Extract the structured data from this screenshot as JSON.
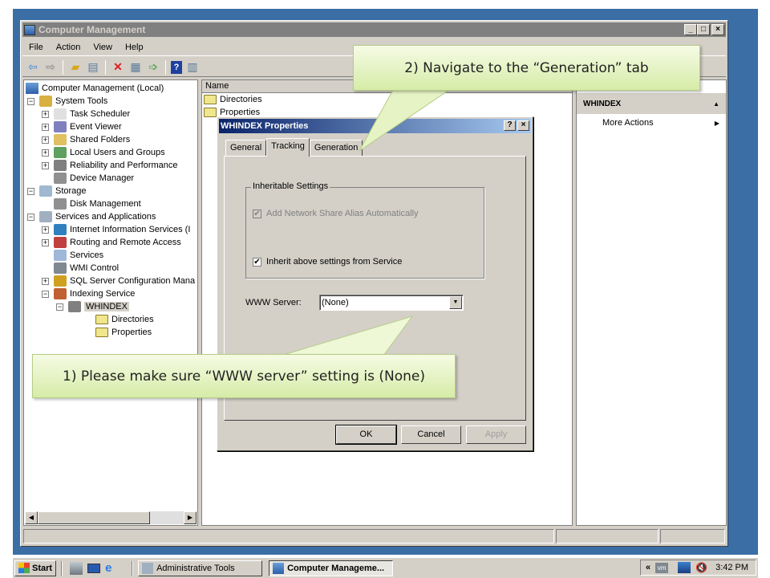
{
  "window": {
    "title": "Computer Management",
    "controls": {
      "minimize": "_",
      "maximize": "□",
      "close": "×"
    }
  },
  "menubar": [
    "File",
    "Action",
    "View",
    "Help"
  ],
  "toolbar": [
    "back-icon",
    "forward-icon",
    "up-folder-icon",
    "show-hide-tree-icon",
    "delete-icon",
    "properties-icon",
    "export-icon",
    "help-icon",
    "show-hide-action-pane-icon"
  ],
  "tree": {
    "root": "Computer Management (Local)",
    "items": [
      {
        "label": "System Tools",
        "expander": "−"
      },
      {
        "label": "Task Scheduler",
        "expander": "+"
      },
      {
        "label": "Event Viewer",
        "expander": "+"
      },
      {
        "label": "Shared Folders",
        "expander": "+"
      },
      {
        "label": "Local Users and Groups",
        "expander": "+"
      },
      {
        "label": "Reliability and Performance",
        "expander": "+"
      },
      {
        "label": "Device Manager",
        "expander": ""
      },
      {
        "label": "Storage",
        "expander": "−"
      },
      {
        "label": "Disk Management",
        "expander": ""
      },
      {
        "label": "Services and Applications",
        "expander": "−"
      },
      {
        "label": "Internet Information Services (I",
        "expander": "+"
      },
      {
        "label": "Routing and Remote Access",
        "expander": "+"
      },
      {
        "label": "Services",
        "expander": ""
      },
      {
        "label": "WMI Control",
        "expander": ""
      },
      {
        "label": "SQL Server Configuration Mana",
        "expander": "+"
      },
      {
        "label": "Indexing Service",
        "expander": "−"
      },
      {
        "label": "WHINDEX",
        "expander": "−"
      },
      {
        "label": "Directories",
        "expander": ""
      },
      {
        "label": "Properties",
        "expander": ""
      }
    ]
  },
  "list": {
    "header": "Name",
    "rows": [
      "Directories",
      "Properties"
    ]
  },
  "actions": {
    "header": "WHINDEX",
    "items": [
      "More Actions"
    ]
  },
  "dialog": {
    "title": "WHINDEX Properties",
    "help_btn": "?",
    "close_btn": "×",
    "tabs": [
      "General",
      "Tracking",
      "Generation"
    ],
    "active_tab": "Tracking",
    "group_label": "Inheritable Settings",
    "chk_alias": {
      "label": "Add Network Share Alias Automatically",
      "checked": true,
      "disabled": true
    },
    "chk_inherit": {
      "label": "Inherit above settings from Service",
      "checked": true
    },
    "www_label": "WWW Server:",
    "www_value": "(None)",
    "ok": "OK",
    "cancel": "Cancel",
    "apply": "Apply"
  },
  "callouts": {
    "step1": "1) Please make sure “WWW server”  setting is (None)",
    "step2": "2) Navigate to the “Generation”  tab"
  },
  "taskbar": {
    "start": "Start",
    "buttons": [
      "Administrative Tools",
      "Computer Manageme..."
    ],
    "tray_expand": "«",
    "clock": "3:42 PM"
  }
}
